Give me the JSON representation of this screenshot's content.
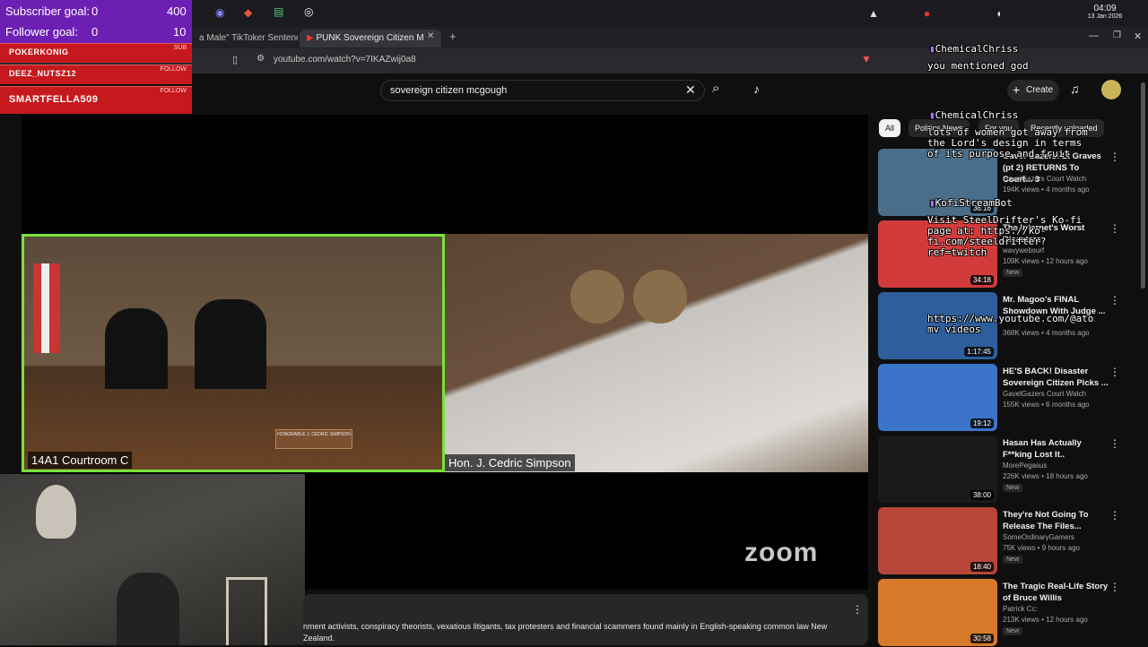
{
  "goals": {
    "subscriber_label": "Subscriber goal:",
    "subscriber_current": "0",
    "subscriber_target": "400",
    "follower_label": "Follower goal:",
    "follower_current": "0",
    "follower_target": "10"
  },
  "events": [
    {
      "name": "POKERKONIG",
      "tag": "SUB"
    },
    {
      "name": "DEEZ_NUTSZ12",
      "tag": "FOLLOW"
    },
    {
      "name": "SMARTFELLA509",
      "tag": "FOLLOW"
    }
  ],
  "clock": {
    "time": "04:09",
    "date": "13 Jan 2026"
  },
  "browser": {
    "tab1": "a Male\" TikToker Sentence",
    "tab2": "PUNK Sovereign Citizen M",
    "url": "youtube.com/watch?v=7IKAZwij0a8"
  },
  "youtube": {
    "search_value": "sovereign citizen mcgough",
    "create_label": "Create",
    "chips": [
      "All",
      "Politics News",
      "For you",
      "Recently uploaded"
    ]
  },
  "video": {
    "panel1_caption": "14A1 Courtroom C",
    "panel2_caption": "Hon. J. Cedric Simpson",
    "nameplate": "HONORABLE J. CEDRIC SIMPSON",
    "watermark": "zoom"
  },
  "description": {
    "text": "nment activists, conspiracy theorists, vexatious litigants, tax protesters and financial scammers found mainly in English-speaking common law New Zealand."
  },
  "recommendations": [
    {
      "title": "Gavel Gazers: Lt Graves (pt 2) RETURNS To Court... 3",
      "channel": "GavelGazers Court Watch",
      "meta": "194K views • 4 months ago",
      "dur": "36:16",
      "new": ""
    },
    {
      "title": "The Internet's Worst Disasters",
      "channel": "wavywebsurf",
      "meta": "109K views • 12 hours ago",
      "dur": "34:18",
      "new": "New"
    },
    {
      "title": "Mr. Magoo's FINAL Showdown With Judge ...",
      "channel": "",
      "meta": "368K views • 4 months ago",
      "dur": "1:17:45",
      "new": ""
    },
    {
      "title": "HE'S BACK! Disaster Sovereign Citizen Picks ...",
      "channel": "GavelGazers Court Watch",
      "meta": "155K views • 6 months ago",
      "dur": "19:12",
      "new": ""
    },
    {
      "title": "Hasan Has Actually F**king Lost It..",
      "channel": "MorePegasus",
      "meta": "226K views • 18 hours ago",
      "dur": "38:00",
      "new": "New"
    },
    {
      "title": "They're Not Going To Release The Files...",
      "channel": "SomeOrdinaryGamers",
      "meta": "75K views • 9 hours ago",
      "dur": "18:40",
      "new": "New"
    },
    {
      "title": "The Tragic Real-Life Story of Bruce Willis",
      "channel": "Patrick Cc:",
      "meta": "213K views • 12 hours ago",
      "dur": "30:58",
      "new": "New"
    }
  ],
  "chat": [
    {
      "user": "ChemicalChriss",
      "msg": "you mentioned god"
    },
    {
      "user": "ChemicalChriss",
      "msg": "lots of women got away from\nthe Lord's design in terms\nof its purpose and fruit"
    },
    {
      "user": "KofiStreamBot",
      "msg": "Visit SteelDrifter's Ko-fi\npage at: https://ko-\nfi.com/steeldrifter?\nref=twitch"
    },
    {
      "user": "",
      "msg": "https://www.youtube.com/@ato\nmv videos"
    }
  ],
  "thumb_colors": [
    "#4a6e8a",
    "#d23b3b",
    "#2e5f9c",
    "#3b74c8",
    "#1a1a1a",
    "#b8453a",
    "#d67a2a"
  ]
}
